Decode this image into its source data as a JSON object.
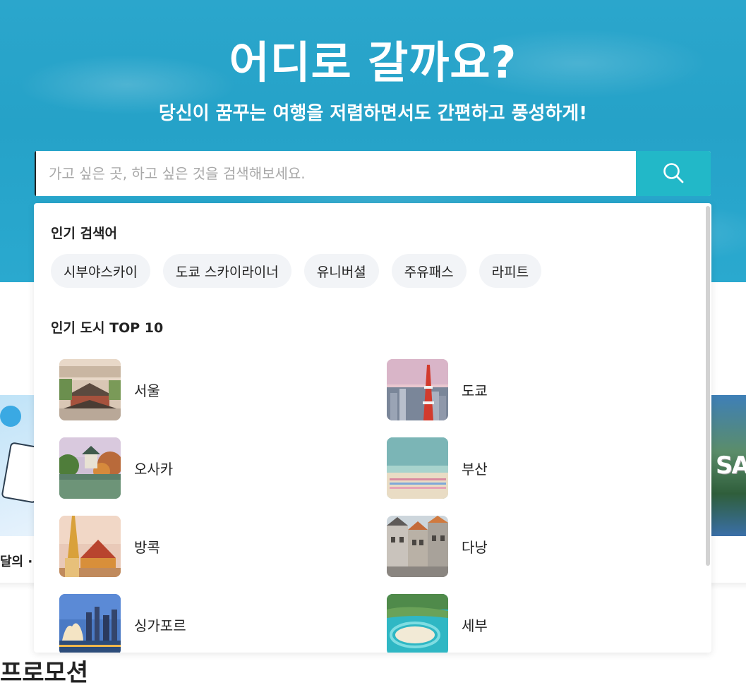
{
  "hero": {
    "title": "어디로 갈까요?",
    "subtitle": "당신이 꿈꾸는 여행을 저렴하면서도 간편하고 풍성하게!"
  },
  "search": {
    "placeholder": "가고 싶은 곳, 하고 싶은 것을 검색해보세요.",
    "button_icon": "search-icon",
    "accent_color": "#22b8c8"
  },
  "popular_searches": {
    "title": "인기 검색어",
    "items": [
      "시부야스카이",
      "도쿄 스카이라이너",
      "유니버셜",
      "주유패스",
      "라피트"
    ]
  },
  "top_cities": {
    "title": "인기 도시 TOP 10",
    "items": [
      {
        "name": "서울"
      },
      {
        "name": "도쿄"
      },
      {
        "name": "오사카"
      },
      {
        "name": "부산"
      },
      {
        "name": "방콕"
      },
      {
        "name": "다낭"
      },
      {
        "name": "싱가포르"
      },
      {
        "name": "세부"
      }
    ]
  },
  "background": {
    "card_label_fragment": "달의 ·",
    "card_right_sign": "SA",
    "promo_title": "프로모션"
  }
}
